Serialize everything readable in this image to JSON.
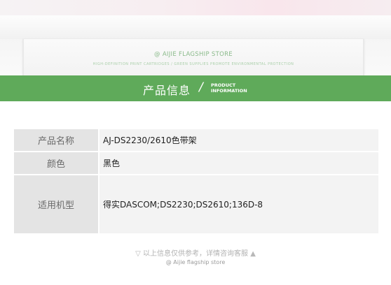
{
  "banner": {
    "store_name": "@ AIJIE FLAGSHIP STORE",
    "tagline": "HIGH-DEFINITION PRINT CARTRIDGES / GREEN SUPPLIES PROMOTE ENVIRONMENTAL PROTECTION"
  },
  "section_header": {
    "title_cn": "产品信息",
    "divider": "/",
    "title_en_line1": "PRODUCT",
    "title_en_line2": "INFORMATION",
    "background_color": "#5faa5a"
  },
  "product_table": {
    "rows": [
      {
        "label": "产品名称",
        "value": "AJ-DS2230/2610色带架"
      },
      {
        "label": "颜色",
        "value": "黑色"
      },
      {
        "label": "适用机型",
        "value": "得实DASCOM;DS2230;DS2610;136D-8"
      }
    ]
  },
  "footer": {
    "down_arrow": "▽",
    "note": "以上信息仅供参考，详情咨询客服",
    "up_arrow": "▲",
    "store": "@ Aijie flagship store"
  }
}
